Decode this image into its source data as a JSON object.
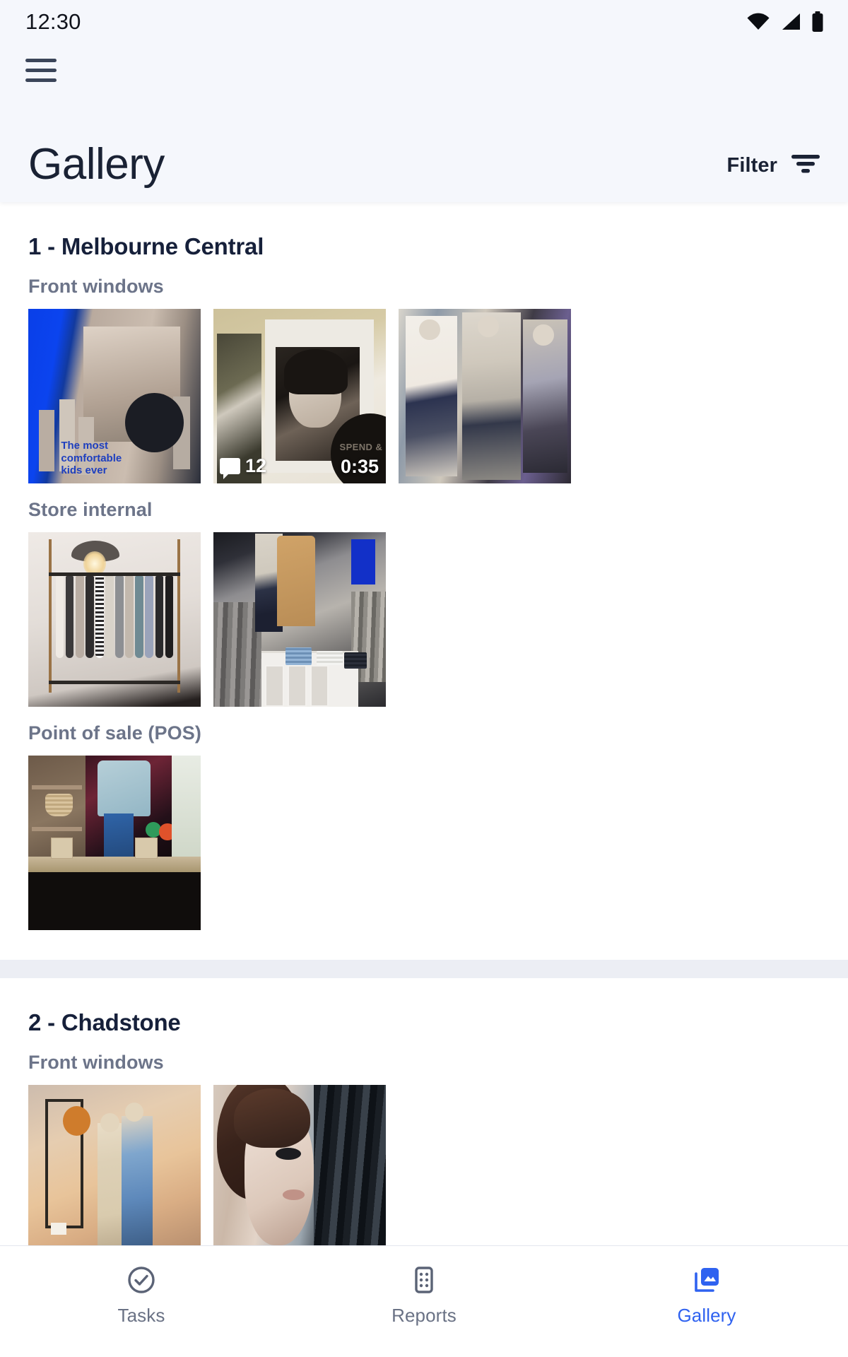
{
  "status_bar": {
    "time": "12:30",
    "icons": [
      "wifi-icon",
      "cellular-signal-icon",
      "battery-icon"
    ]
  },
  "app_bar": {
    "menu_icon": "hamburger-menu-icon"
  },
  "header": {
    "title": "Gallery",
    "filter_label": "Filter",
    "filter_icon": "filter-icon"
  },
  "colors": {
    "header_background": "#f5f7fc",
    "title_text": "#1a2234",
    "category_text": "#6c7489",
    "store_title_text": "#16203a",
    "accent_active": "#2f62f0",
    "nav_inactive": "#6a7285",
    "divider": "#eceef4"
  },
  "sections": [
    {
      "store_title": "1 - Melbourne Central",
      "categories": [
        {
          "label": "Front windows",
          "items": [
            {
              "art": "art-kids",
              "alt": "Kids clothing window display with blue lighting",
              "comments": null,
              "duration": null
            },
            {
              "art": "art-poster",
              "alt": "Mannequin beside large black and white portrait poster",
              "comments": "12",
              "duration": "0:35"
            },
            {
              "art": "art-mannequins",
              "alt": "Row of mannequins in shop front window",
              "comments": null,
              "duration": null
            }
          ]
        },
        {
          "label": "Store internal",
          "items": [
            {
              "art": "art-rack",
              "alt": "Clothing rack under pendant lamp",
              "comments": null,
              "duration": null
            },
            {
              "art": "art-store",
              "alt": "Store interior with mannequins and folded denim stacks",
              "comments": null,
              "duration": null
            }
          ]
        },
        {
          "label": "Point of sale (POS)",
          "items": [
            {
              "art": "art-pos",
              "alt": "Point of sale counter with display backdrop",
              "comments": null,
              "duration": null
            }
          ]
        }
      ]
    },
    {
      "store_title": "2 - Chadstone",
      "categories": [
        {
          "label": "Front windows",
          "items": [
            {
              "art": "art-chad1",
              "alt": "Warm lit window display with two mannequins",
              "comments": null,
              "duration": null
            },
            {
              "art": "art-chad2",
              "alt": "Close up of mannequin face with dark bob hair",
              "comments": null,
              "duration": null
            }
          ]
        }
      ]
    }
  ],
  "bottom_nav": {
    "items": [
      {
        "label": "Tasks",
        "icon": "check-circle-icon",
        "active": false
      },
      {
        "label": "Reports",
        "icon": "report-list-icon",
        "active": false
      },
      {
        "label": "Gallery",
        "icon": "gallery-image-icon",
        "active": true
      }
    ]
  }
}
